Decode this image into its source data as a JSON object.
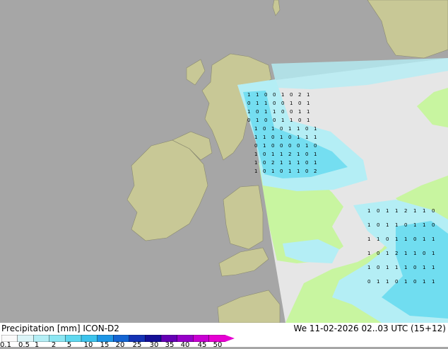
{
  "title": {
    "variable": "Precipitation [mm]",
    "model": "ICON-D2",
    "datetime": "We 11-02-2026 02..03 UTC (15+12)"
  },
  "legend": {
    "ticks": [
      "0.1",
      "0.5",
      "1",
      "2",
      "5",
      "10",
      "15",
      "20",
      "25",
      "30",
      "35",
      "40",
      "45",
      "50"
    ],
    "colors": [
      "#fafafa",
      "#dcf5f8",
      "#b4eef5",
      "#8ce6f2",
      "#5fd8ef",
      "#3cc3ec",
      "#1e96e6",
      "#1464d2",
      "#1432b4",
      "#140f96",
      "#6400b4",
      "#9600c8",
      "#c800d2",
      "#e600d2"
    ]
  },
  "map_colors": {
    "sea": "#a6a6a6",
    "land_outside_domain": "#c8c896",
    "domain_no_rain": "#e6e6e6",
    "domain_land": "#c8f5a0",
    "rain_light": "#b4eef5",
    "rain_medium": "#5fd8ef"
  },
  "grid_values": [
    {
      "t": "1"
    },
    {
      "t": "1"
    },
    {
      "t": "0"
    },
    {
      "t": "0"
    },
    {
      "t": "1"
    },
    {
      "t": "0"
    },
    {
      "t": "2"
    },
    {
      "t": "1"
    },
    {
      "t": "0"
    },
    {
      "t": "1"
    },
    {
      "t": "1"
    },
    {
      "t": "0"
    },
    {
      "t": "0"
    },
    {
      "t": "1"
    },
    {
      "t": "0"
    },
    {
      "t": "1"
    },
    {
      "t": "1"
    },
    {
      "t": "0"
    },
    {
      "t": "1"
    },
    {
      "t": "1"
    },
    {
      "t": "0"
    },
    {
      "t": "0"
    },
    {
      "t": "1"
    },
    {
      "t": "1"
    },
    {
      "t": "0"
    },
    {
      "t": "1"
    },
    {
      "t": "0"
    },
    {
      "t": "0"
    },
    {
      "t": "1"
    },
    {
      "t": "1"
    },
    {
      "t": "0"
    },
    {
      "t": "1"
    },
    {
      "t": "1"
    },
    {
      "t": "0"
    },
    {
      "t": "1"
    },
    {
      "t": "0"
    },
    {
      "t": "1"
    },
    {
      "t": "1"
    },
    {
      "t": "0"
    },
    {
      "t": "1"
    },
    {
      "t": "1"
    },
    {
      "t": "1"
    },
    {
      "t": "0"
    },
    {
      "t": "1"
    },
    {
      "t": "0"
    },
    {
      "t": "1"
    },
    {
      "t": "1"
    },
    {
      "t": "1"
    },
    {
      "t": "0"
    },
    {
      "t": "1"
    },
    {
      "t": "0"
    },
    {
      "t": "0"
    },
    {
      "t": "0"
    },
    {
      "t": "0"
    },
    {
      "t": "1"
    },
    {
      "t": "0"
    },
    {
      "t": "1"
    },
    {
      "t": "0"
    },
    {
      "t": "1"
    },
    {
      "t": "1"
    },
    {
      "t": "2"
    },
    {
      "t": "1"
    },
    {
      "t": "0"
    },
    {
      "t": "1"
    },
    {
      "t": "1"
    },
    {
      "t": "0"
    },
    {
      "t": "2"
    },
    {
      "t": "1"
    },
    {
      "t": "1"
    },
    {
      "t": "1"
    },
    {
      "t": "0"
    },
    {
      "t": "1"
    },
    {
      "t": "1"
    },
    {
      "t": "0"
    },
    {
      "t": "1"
    },
    {
      "t": "0"
    },
    {
      "t": "1"
    },
    {
      "t": "1"
    },
    {
      "t": "0"
    },
    {
      "t": "2"
    },
    {
      "t": "1"
    },
    {
      "t": "0"
    },
    {
      "t": "1"
    },
    {
      "t": "1"
    },
    {
      "t": "2"
    },
    {
      "t": "1"
    },
    {
      "t": "1"
    },
    {
      "t": "0"
    },
    {
      "t": "1"
    },
    {
      "t": "0"
    },
    {
      "t": "1"
    },
    {
      "t": "1"
    },
    {
      "t": "0"
    },
    {
      "t": "1"
    },
    {
      "t": "1"
    },
    {
      "t": "0"
    },
    {
      "t": "1"
    },
    {
      "t": "1"
    },
    {
      "t": "0"
    },
    {
      "t": "1"
    },
    {
      "t": "1"
    },
    {
      "t": "0"
    },
    {
      "t": "1"
    },
    {
      "t": "1"
    },
    {
      "t": "1"
    },
    {
      "t": "0"
    },
    {
      "t": "1"
    },
    {
      "t": "2"
    },
    {
      "t": "1"
    },
    {
      "t": "1"
    },
    {
      "t": "0"
    },
    {
      "t": "1"
    },
    {
      "t": "1"
    },
    {
      "t": "0"
    },
    {
      "t": "1"
    },
    {
      "t": "1"
    },
    {
      "t": "1"
    },
    {
      "t": "0"
    },
    {
      "t": "1"
    },
    {
      "t": "1"
    },
    {
      "t": "0"
    },
    {
      "t": "1"
    },
    {
      "t": "1"
    },
    {
      "t": "0"
    },
    {
      "t": "1"
    },
    {
      "t": "0"
    },
    {
      "t": "1"
    },
    {
      "t": "1"
    }
  ]
}
